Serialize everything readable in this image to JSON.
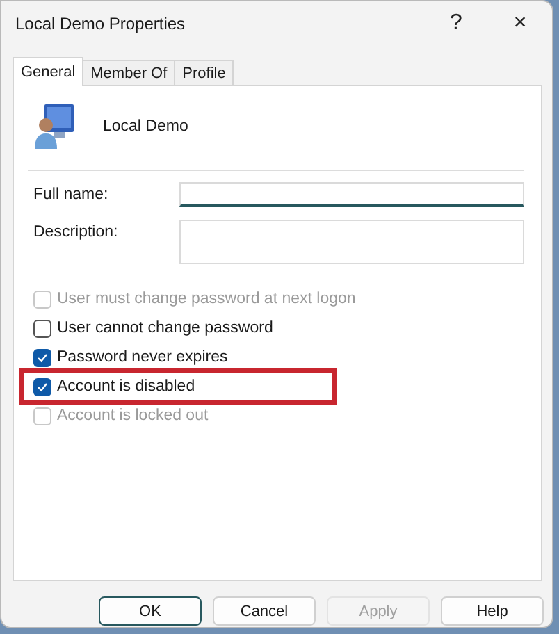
{
  "window": {
    "title": "Local Demo Properties",
    "help": "?",
    "close": "×"
  },
  "tabs": [
    {
      "label": "General",
      "selected": true
    },
    {
      "label": "Member Of",
      "selected": false
    },
    {
      "label": "Profile",
      "selected": false
    }
  ],
  "user": {
    "name": "Local Demo"
  },
  "fields": [
    {
      "label": "Full name:",
      "focused": true,
      "kind": "single"
    },
    {
      "label": "Description:",
      "focused": false,
      "kind": "multi"
    }
  ],
  "options": [
    {
      "label": "User must change password at next logon",
      "checked": false,
      "disabled": true,
      "highlighted": false
    },
    {
      "label": "User cannot change password",
      "checked": false,
      "disabled": false,
      "highlighted": false
    },
    {
      "label": "Password never expires",
      "checked": true,
      "disabled": false,
      "highlighted": false
    },
    {
      "label": "Account is disabled",
      "checked": true,
      "disabled": false,
      "highlighted": true
    },
    {
      "label": "Account is locked out",
      "checked": false,
      "disabled": true,
      "highlighted": false
    }
  ],
  "buttons": [
    {
      "label": "OK",
      "default": true,
      "disabled": false
    },
    {
      "label": "Cancel",
      "default": false,
      "disabled": false
    },
    {
      "label": "Apply",
      "default": false,
      "disabled": true
    },
    {
      "label": "Help",
      "default": false,
      "disabled": false
    }
  ]
}
